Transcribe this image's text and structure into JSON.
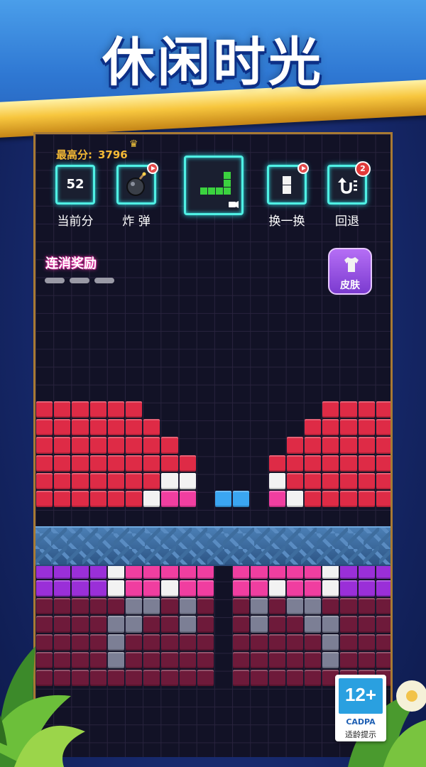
{
  "banner": {
    "title": "休闲时光"
  },
  "header": {
    "best_label": "最高分:",
    "best_value": "3796"
  },
  "tools": {
    "score_value": "52",
    "score_label": "当前分",
    "bomb_label": "炸 弹",
    "swap_label": "换一换",
    "undo_label": "回退",
    "undo_count": "2"
  },
  "combo": {
    "label": "连消奖励"
  },
  "skin": {
    "label": "皮肤"
  },
  "rating": {
    "age": "12+",
    "org": "CADPA",
    "tip": "适龄提示"
  },
  "colors": {
    "red": "#de2b46",
    "pink": "#f03ea0",
    "white": "#f2f2f2",
    "blue": "#3aa6f2",
    "purple": "#9a2fd8",
    "dark_red": "#6e1a3a",
    "gray": "#7c7f95"
  },
  "board": {
    "legend": {
      "R": "red",
      "P": "pink",
      "W": "white",
      "B": "blue",
      "V": "purple",
      "D": "dark_red",
      "G": "gray"
    },
    "rows": [
      "RRRRRR..........RRRRR",
      "RRRRRRR........RRRRRR",
      "RRRRRRRR......RRRRRRR",
      "RRRRRRRRR....RRRRRRRR",
      "RRRRRRRWW....WRRRRRRR",
      "RRRRRRWPP.BB.PWRRRRRR",
      "",
      "",
      "BBBBBWPPPP.PPPPWBBBBB",
      "VVVVWPPPPP.PPPPPWVVVV",
      "VVVVWPPWPP.PPWPPWVVVV",
      "DDDDDGGDGD.DGDGGDDDDD",
      "DDDDGGDDGD.DGDDGGDDDD",
      "DDDDGDDDDD.DDDDDGDDDD",
      "DDDDGDDDDD.DDDDDGDDDD",
      "DDDDDDDDDD.DDDDDDDDDD"
    ]
  }
}
